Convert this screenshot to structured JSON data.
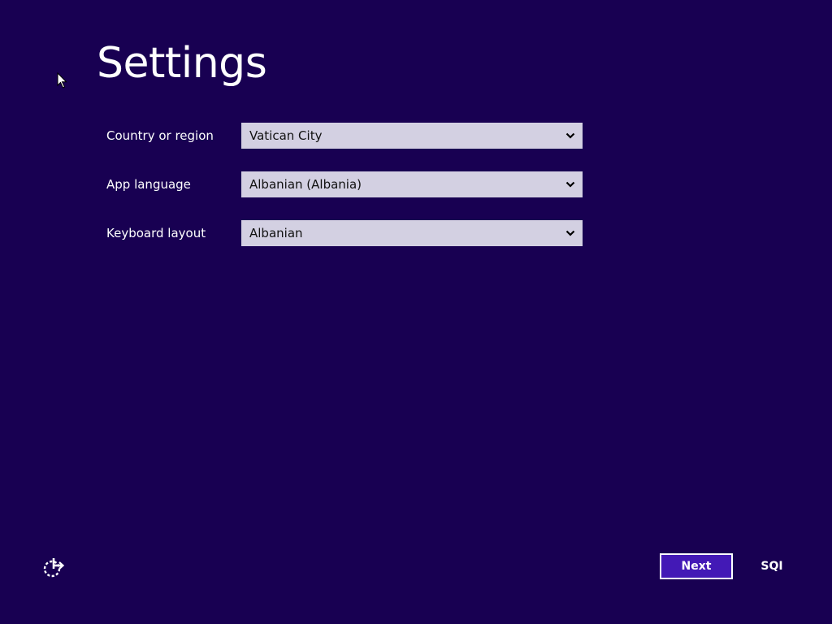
{
  "header": {
    "title": "Settings"
  },
  "fields": [
    {
      "label": "Country or region",
      "value": "Vatican City"
    },
    {
      "label": "App language",
      "value": "Albanian (Albania)"
    },
    {
      "label": "Keyboard layout",
      "value": "Albanian"
    }
  ],
  "footer": {
    "ease_icon": "ease-of-access-icon",
    "next_label": "Next",
    "input_indicator": "SQI"
  },
  "colors": {
    "background": "#180052",
    "select_background": "#d3d0e2",
    "accent_button": "#4319b6"
  }
}
